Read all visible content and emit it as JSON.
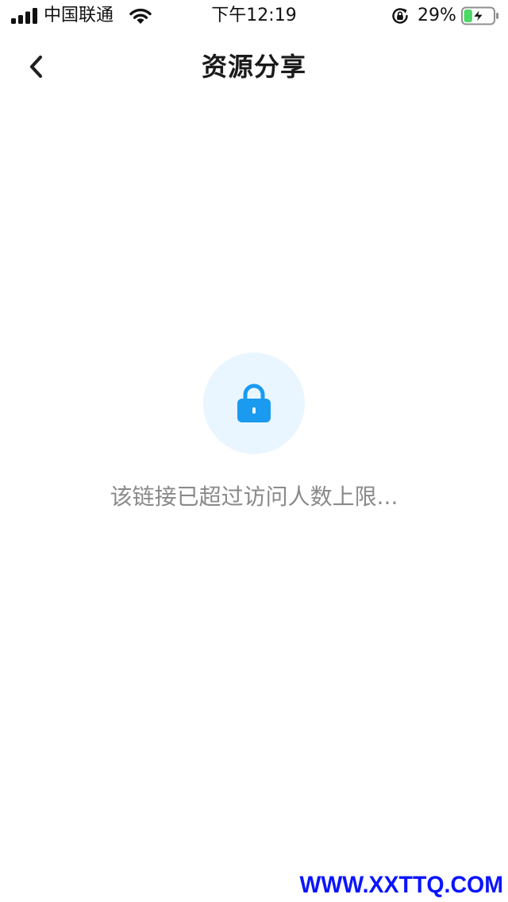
{
  "status_bar": {
    "carrier": "中国联通",
    "time": "下午12:19",
    "battery_percent": "29%",
    "battery_level": 0.29,
    "icons": {
      "signal": "signal-bars-icon",
      "wifi": "wifi-icon",
      "rotation_lock": "rotation-lock-icon",
      "battery": "battery-charging-icon"
    }
  },
  "nav": {
    "back_icon": "chevron-left-icon",
    "title": "资源分享"
  },
  "main": {
    "lock_icon": "lock-icon",
    "message": "该链接已超过访问人数上限..."
  },
  "watermark": "WWW.XXTTQ.COM",
  "colors": {
    "accent": "#1a9bf0",
    "lock_circle": "#eaf6ff",
    "message_text": "#8a8a8a",
    "battery_fill": "#4cd964",
    "watermark": "#0a14ff"
  }
}
